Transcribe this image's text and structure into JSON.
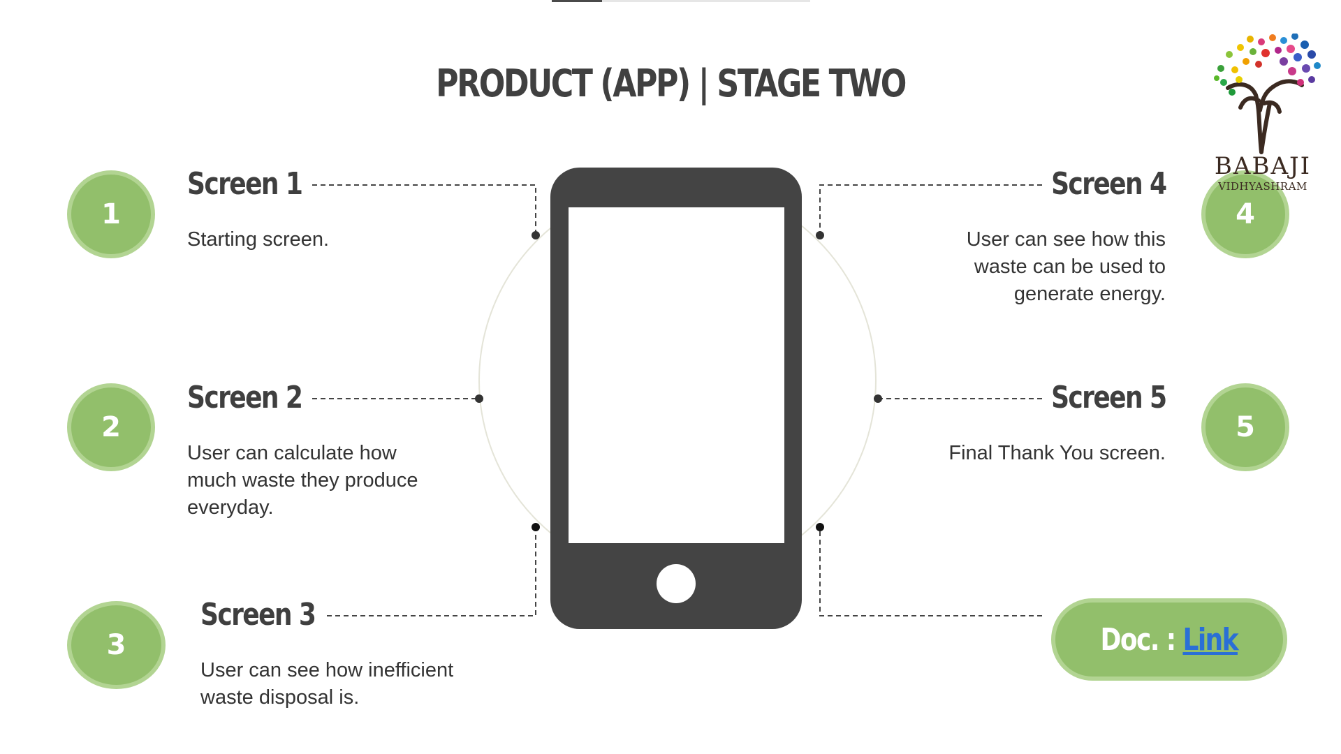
{
  "slide": {
    "title": "PRODUCT (APP) | STAGE TWO"
  },
  "screens": [
    {
      "number": "1",
      "heading": "Screen 1",
      "description": "Starting screen."
    },
    {
      "number": "2",
      "heading": "Screen 2",
      "description": "User can calculate how much waste they produce everyday."
    },
    {
      "number": "3",
      "heading": "Screen 3",
      "description": "User can see how inefficient waste disposal is."
    },
    {
      "number": "4",
      "heading": "Screen 4",
      "description": "User can see how this waste can be used to generate energy."
    },
    {
      "number": "5",
      "heading": "Screen 5",
      "description": "Final Thank You screen."
    }
  ],
  "doc": {
    "label": "Doc. :",
    "link_text": "Link"
  },
  "logo": {
    "name": "BABAJI",
    "subtitle": "VIDHYASHRAM"
  },
  "colors": {
    "accent_green": "#92bf6b",
    "accent_green_border": "#b2d492",
    "phone": "#444444",
    "link": "#2a6fd6"
  }
}
